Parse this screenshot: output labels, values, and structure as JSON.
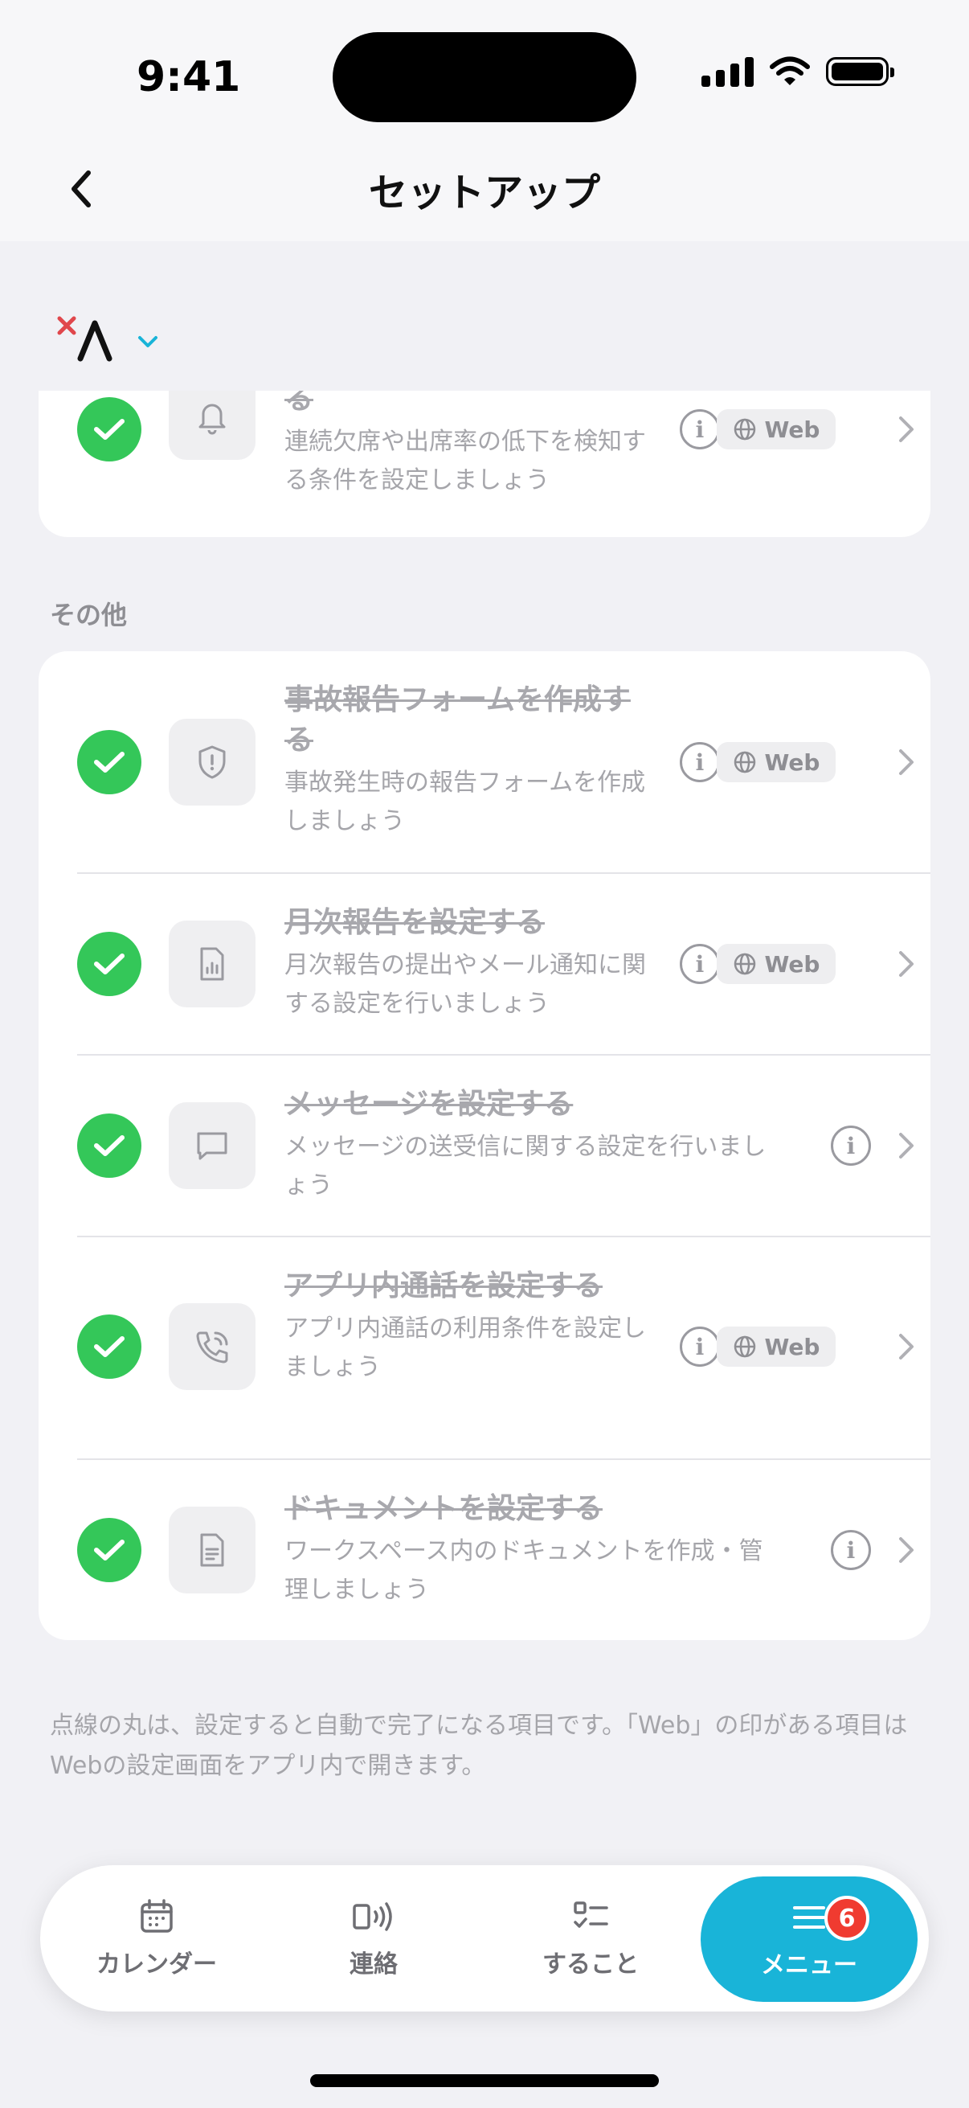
{
  "status_bar": {
    "time": "9:41"
  },
  "header": {
    "title": "セットアップ"
  },
  "top_card": {
    "title_fragment": "る",
    "description": "連続欠席や出席率の低下を検知する条件を設定しましょう",
    "web_label": "Web"
  },
  "section": {
    "label": "その他"
  },
  "items": [
    {
      "title": "事故報告フォームを作成する",
      "description": "事故発生時の報告フォームを作成しましょう",
      "web_label": "Web",
      "icon": "shield-alert-icon"
    },
    {
      "title": "月次報告を設定する",
      "description": "月次報告の提出やメール通知に関する設定を行いましょう",
      "web_label": "Web",
      "icon": "report-chart-icon"
    },
    {
      "title": "メッセージを設定する",
      "description": "メッセージの送受信に関する設定を行いましょう",
      "web_label": "",
      "icon": "message-bubble-icon"
    },
    {
      "title": "アプリ内通話を設定する",
      "description": "アプリ内通話の利用条件を設定しましょう",
      "web_label": "Web",
      "icon": "phone-call-icon"
    },
    {
      "title": "ドキュメントを設定する",
      "description": "ワークスペース内のドキュメントを作成・管理しましょう",
      "web_label": "",
      "icon": "document-icon"
    }
  ],
  "footnote": "点線の丸は、設定すると自動で完了になる項目です。「Web」の印がある項目はWebの設定画面をアプリ内で開きます。",
  "tabbar": {
    "tabs": [
      {
        "label": "カレンダー",
        "icon": "calendar-icon"
      },
      {
        "label": "連絡",
        "icon": "broadcast-icon"
      },
      {
        "label": "すること",
        "icon": "checklist-icon"
      },
      {
        "label": "メニュー",
        "icon": "menu-icon"
      }
    ],
    "menu_badge": "6"
  },
  "colors": {
    "accent": "#19b4d8",
    "check": "#34c759",
    "badge": "#f03b30"
  }
}
